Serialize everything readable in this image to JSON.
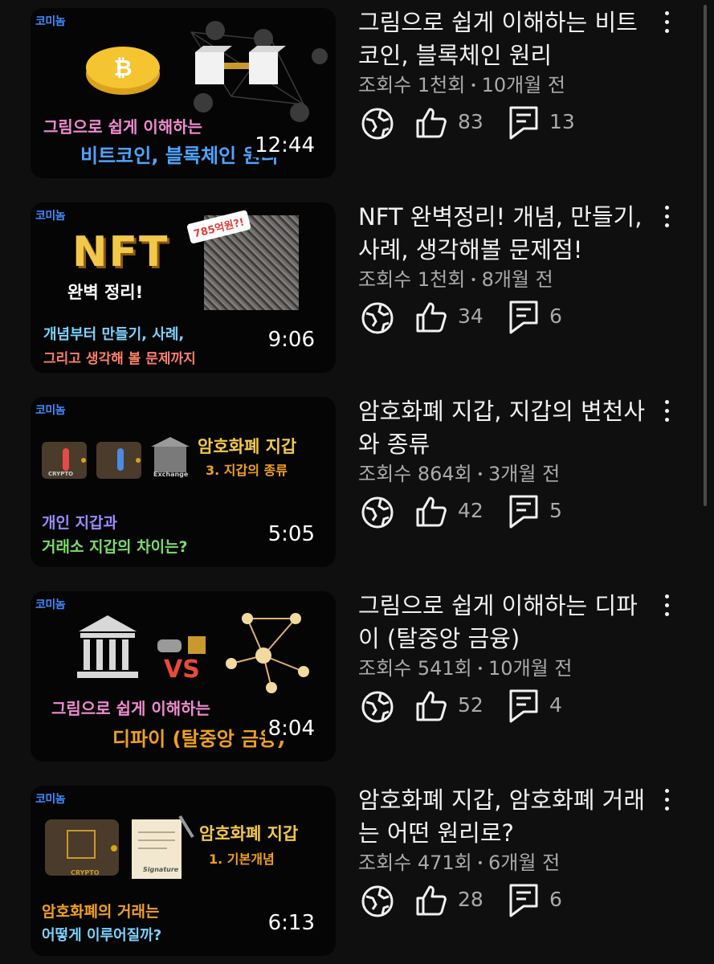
{
  "brand_label": "코미놈",
  "videos": [
    {
      "title": "그림으로 쉽게 이해하는 비트코인, 블록체인 원리",
      "views": "조회수 1천회",
      "age": "10개월 전",
      "likes": "83",
      "comments": "13",
      "duration": "12:44",
      "thumb": {
        "line1": "그림으로 쉽게 이해하는",
        "line2": "비트코인, 블록체인 원리"
      }
    },
    {
      "title": "NFT 완벽정리! 개념, 만들기, 사례, 생각해볼 문제점!",
      "views": "조회수 1천회",
      "age": "8개월 전",
      "likes": "34",
      "comments": "6",
      "duration": "9:06",
      "thumb": {
        "nft": "NFT",
        "sub": "완벽 정리!",
        "badge": "785억원?!",
        "line1": "개념부터 만들기, 사례,",
        "line2": "그리고 생각해 볼 문제까지"
      }
    },
    {
      "title": "암호화폐 지갑, 지갑의 변천사와 종류",
      "views": "조회수 864회",
      "age": "3개월 전",
      "likes": "42",
      "comments": "5",
      "duration": "5:05",
      "thumb": {
        "head": "암호화폐 지갑",
        "sub": "3. 지갑의 종류",
        "line1": "개인 지갑과",
        "line2": "거래소 지갑의 차이는?",
        "exchange": "Exchange",
        "crypto": "CRYPTO"
      }
    },
    {
      "title": "그림으로 쉽게  이해하는 디파이 (탈중앙 금융)",
      "views": "조회수 541회",
      "age": "10개월 전",
      "likes": "52",
      "comments": "4",
      "duration": "8:04",
      "thumb": {
        "vs": "VS",
        "line1": "그림으로 쉽게 이해하는",
        "line2": "디파이 (탈중앙 금융)"
      }
    },
    {
      "title": "암호화폐 지갑, 암호화폐 거래는 어떤 원리로?",
      "views": "조회수 471회",
      "age": "6개월 전",
      "likes": "28",
      "comments": "6",
      "duration": "6:13",
      "thumb": {
        "head": "암호화폐 지갑",
        "sub": "1. 기본개념",
        "line1": "암호화폐의 거래는",
        "line2": "어떻게 이루어질까?",
        "crypto": "CRYPTO",
        "sig": "Signature"
      }
    }
  ]
}
